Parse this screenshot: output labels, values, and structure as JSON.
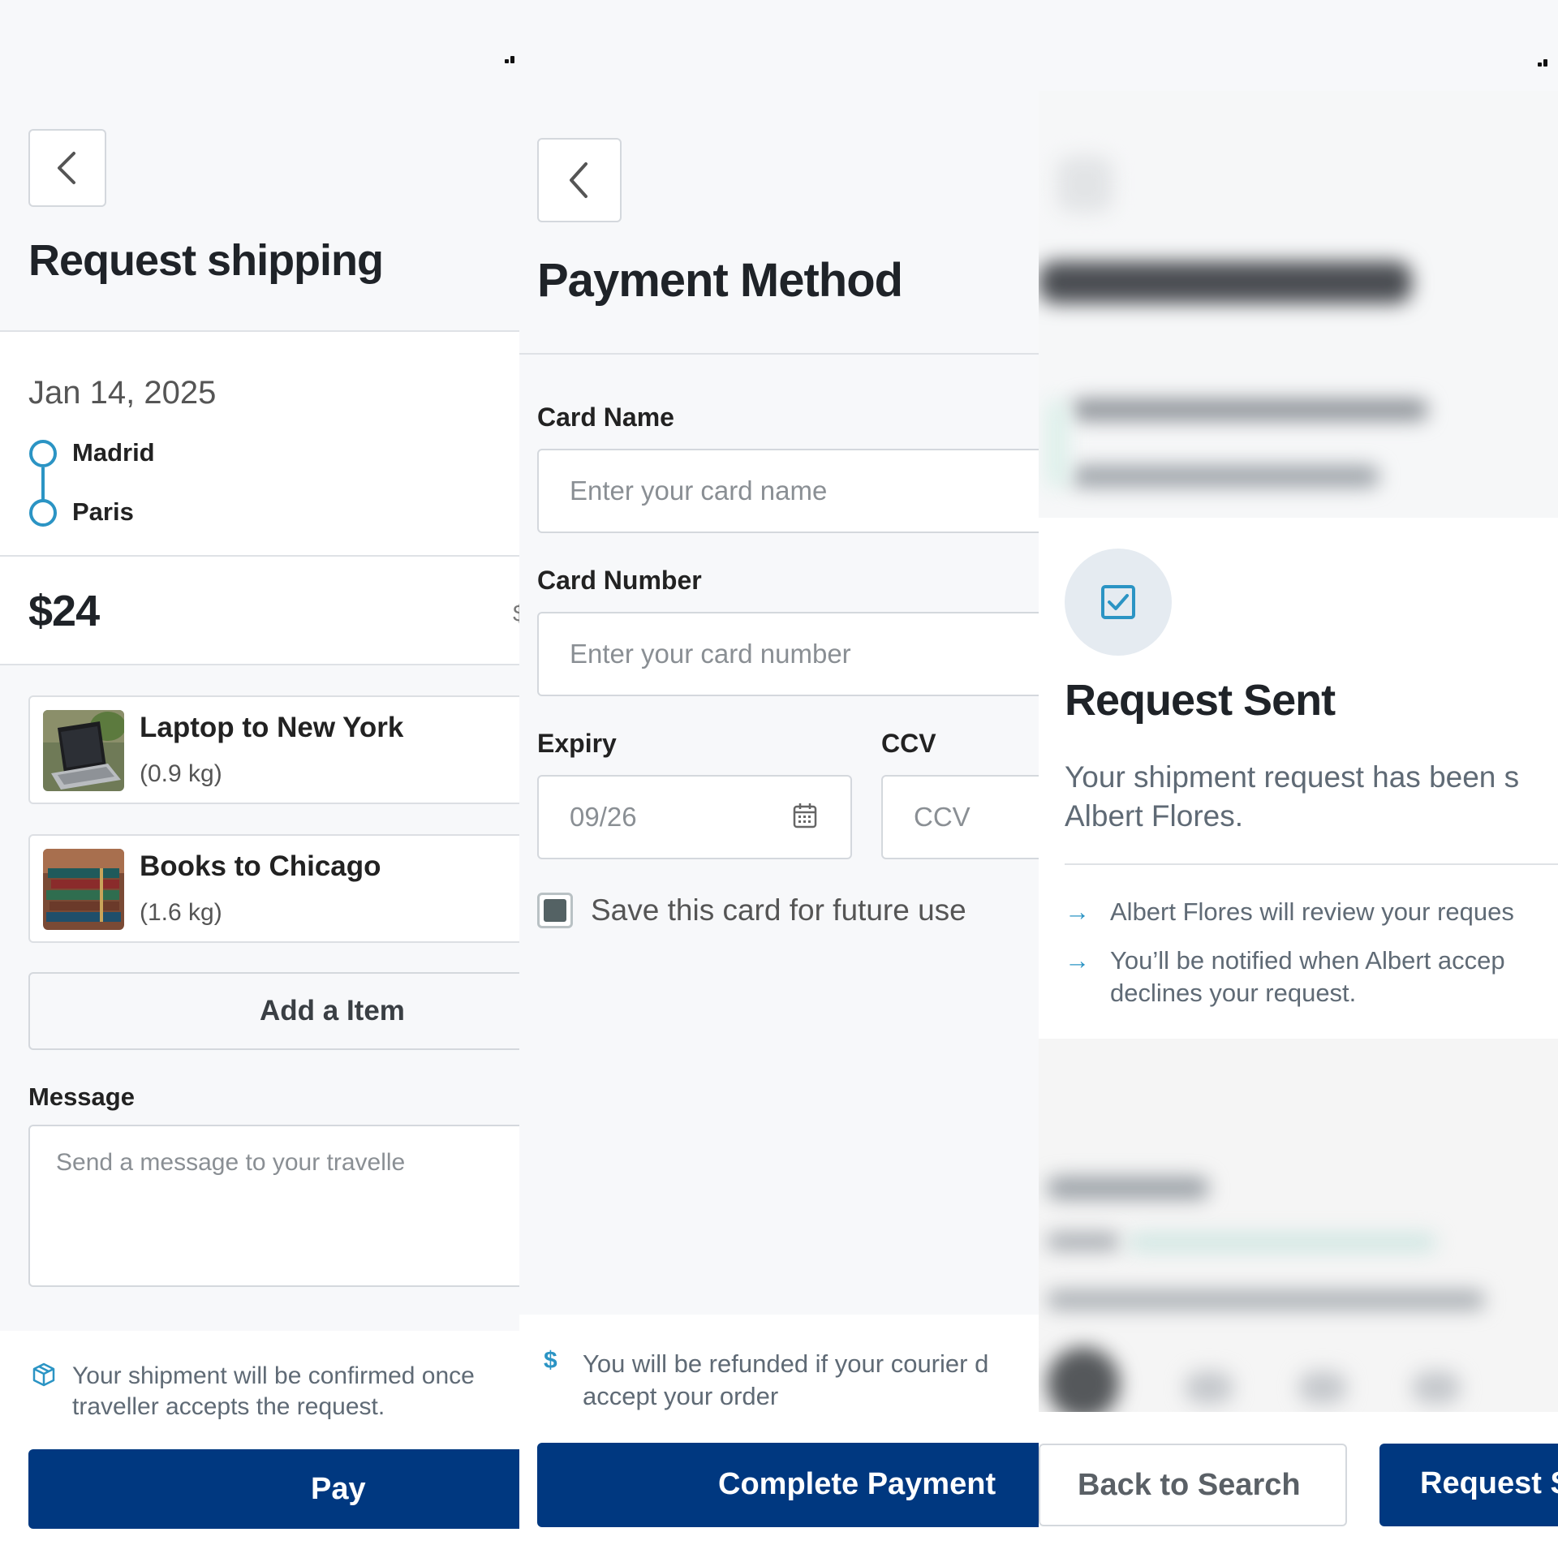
{
  "request_shipping": {
    "title": "Request shipping",
    "date": "Jan 14, 2025",
    "origin": "Madrid",
    "destination": "Paris",
    "price": "$24",
    "price_cut": "$",
    "items": [
      {
        "name": "Laptop to New York",
        "weight": "(0.9 kg)",
        "image": "laptop-photo"
      },
      {
        "name": "Books to Chicago",
        "weight": "(1.6 kg)",
        "image": "books-photo"
      }
    ],
    "add_item_label": "Add a Item",
    "message_label": "Message",
    "message_placeholder": "Send a message to your travelle",
    "note_line1": "Your shipment will be confirmed once",
    "note_line2": "traveller accepts the request.",
    "pay_label": "Pay",
    "accent_color": "#2b94c4",
    "primary_color": "#003880"
  },
  "payment_method": {
    "title": "Payment Method",
    "card_name_label": "Card Name",
    "card_name_placeholder": "Enter your card name",
    "card_number_label": "Card Number",
    "card_number_placeholder": "Enter your card number",
    "expiry_label": "Expiry",
    "expiry_placeholder": "09/26",
    "ccv_label": "CCV",
    "ccv_placeholder": "CCV",
    "save_card_label": "Save this card for future use",
    "save_card_checked": true,
    "refund_line1": "You will be refunded if your courier d",
    "refund_line2": "accept your order",
    "complete_label": "Complete Payment"
  },
  "request_sent": {
    "title": "Request Sent",
    "message_line1": "Your shipment request has been s",
    "message_line2": "Albert Flores.",
    "bullet1": "Albert Flores will review your reques",
    "bullet2_line1": "You’ll be notified when Albert accep",
    "bullet2_line2": "declines your request.",
    "back_label": "Back to Search",
    "request_label": "Request S"
  }
}
